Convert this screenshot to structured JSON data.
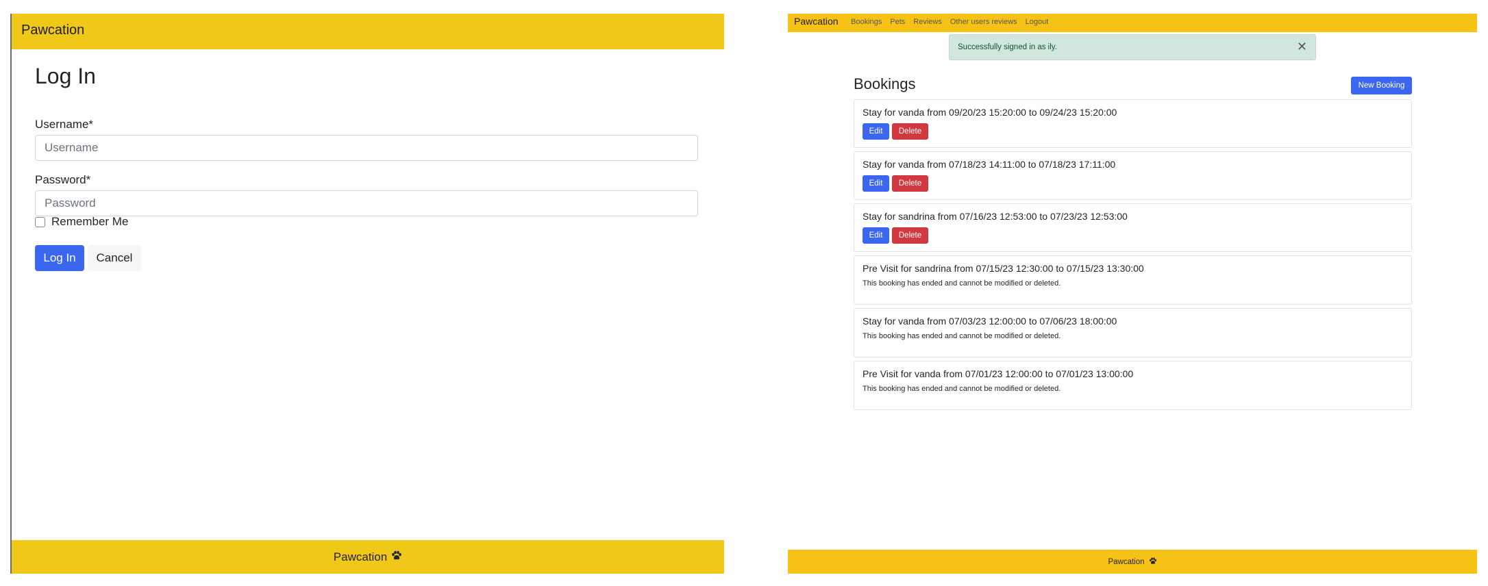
{
  "login_page": {
    "navbar": {
      "brand": "Pawcation"
    },
    "title": "Log In",
    "username": {
      "label": "Username*",
      "placeholder": "Username",
      "value": ""
    },
    "password": {
      "label": "Password*",
      "placeholder": "Password",
      "value": ""
    },
    "remember_me": {
      "label": "Remember Me",
      "checked": false
    },
    "buttons": {
      "submit": "Log In",
      "cancel": "Cancel"
    },
    "footer": {
      "brand": "Pawcation",
      "icon": "paw-icon"
    }
  },
  "bookings_page": {
    "navbar": {
      "brand": "Pawcation",
      "links": [
        "Bookings",
        "Pets",
        "Reviews",
        "Other users reviews",
        "Logout"
      ]
    },
    "alert": {
      "message": "Successfully signed in as ily.",
      "close_icon": "close-icon"
    },
    "title": "Bookings",
    "new_booking_label": "New Booking",
    "bookings": [
      {
        "title": "Stay for vanda from 09/20/23 15:20:00 to 09/24/23 15:20:00",
        "edit_label": "Edit",
        "delete_label": "Delete"
      },
      {
        "title": "Stay for vanda from 07/18/23 14:11:00 to 07/18/23 17:11:00",
        "edit_label": "Edit",
        "delete_label": "Delete"
      },
      {
        "title": "Stay for sandrina from 07/16/23 12:53:00 to 07/23/23 12:53:00",
        "edit_label": "Edit",
        "delete_label": "Delete"
      },
      {
        "title": "Pre Visit for sandrina from 07/15/23 12:30:00 to 07/15/23 13:30:00",
        "note": "This booking has ended and cannot be modified or deleted."
      },
      {
        "title": "Stay for vanda from 07/03/23 12:00:00 to 07/06/23 18:00:00",
        "note": "This booking has ended and cannot be modified or deleted."
      },
      {
        "title": "Pre Visit for vanda from 07/01/23 12:00:00 to 07/01/23 13:00:00",
        "note": "This booking has ended and cannot be modified or deleted."
      }
    ],
    "footer": {
      "brand": "Pawcation",
      "icon": "paw-icon"
    }
  },
  "colors": {
    "navbar_left": "#efc81a",
    "navbar_right": "#f6c215",
    "primary": "#3b66f0",
    "danger": "#d0393f",
    "alert_bg": "#d1e7dd"
  }
}
